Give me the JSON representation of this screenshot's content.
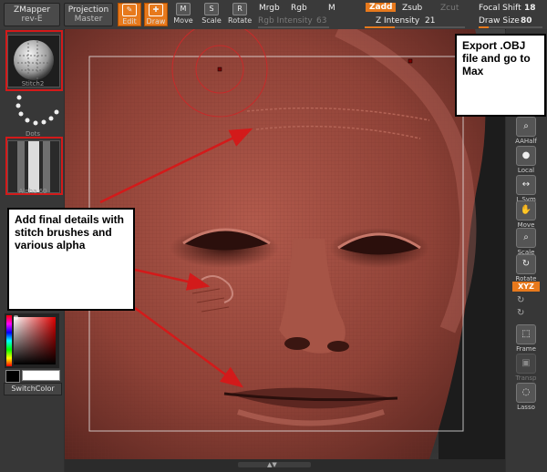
{
  "topbar": {
    "zmapper_label": "ZMapper",
    "zmapper_version": "rev-E",
    "projection_label": "Projection",
    "projection_sub": "Master",
    "tools": [
      {
        "label": "Edit",
        "glyph": "✎"
      },
      {
        "label": "Draw",
        "glyph": "✚"
      },
      {
        "label": "Move",
        "glyph": "M"
      },
      {
        "label": "Scale",
        "glyph": "S"
      },
      {
        "label": "Rotate",
        "glyph": "R"
      }
    ],
    "mrgb": "Mrgb",
    "rgb": "Rgb",
    "m": "M",
    "rgb_intensity_label": "Rgb Intensity",
    "rgb_intensity_value": "63",
    "zadd": "Zadd",
    "zsub": "Zsub",
    "zcut": "Zcut",
    "z_intensity_label": "Z Intensity",
    "z_intensity_value": "21",
    "focal_shift_label": "Focal Shift",
    "focal_shift_value": "18",
    "draw_size_label": "Draw Size",
    "draw_size_value": "80"
  },
  "leftpanel": {
    "brush_name": "Stitch2",
    "stroke_name": "Dots",
    "alpha_name": "Alpha 60",
    "switch_color": "SwitchColor"
  },
  "rightpanel": {
    "tools": [
      {
        "label": "AAHalf",
        "glyph": "⌕"
      },
      {
        "label": "Local",
        "glyph": "●"
      },
      {
        "label": "L.Sym",
        "glyph": "↔"
      },
      {
        "label": "Move",
        "glyph": "✋"
      },
      {
        "label": "Scale",
        "glyph": "⌕"
      },
      {
        "label": "Rotate",
        "glyph": "↻"
      },
      {
        "label": "XYZ",
        "glyph": ""
      },
      {
        "label": "Frame",
        "glyph": "⬚"
      },
      {
        "label": "Transp",
        "glyph": "▣"
      },
      {
        "label": "Lasso",
        "glyph": "◌"
      }
    ]
  },
  "callouts": {
    "export": "Export .OBJ file and go to Max",
    "details": "Add final details with stitch brushes and various alpha"
  },
  "colors": {
    "accent": "#e7791c",
    "highlight_box": "#d31a1a",
    "skin": "#9c4a3e"
  }
}
